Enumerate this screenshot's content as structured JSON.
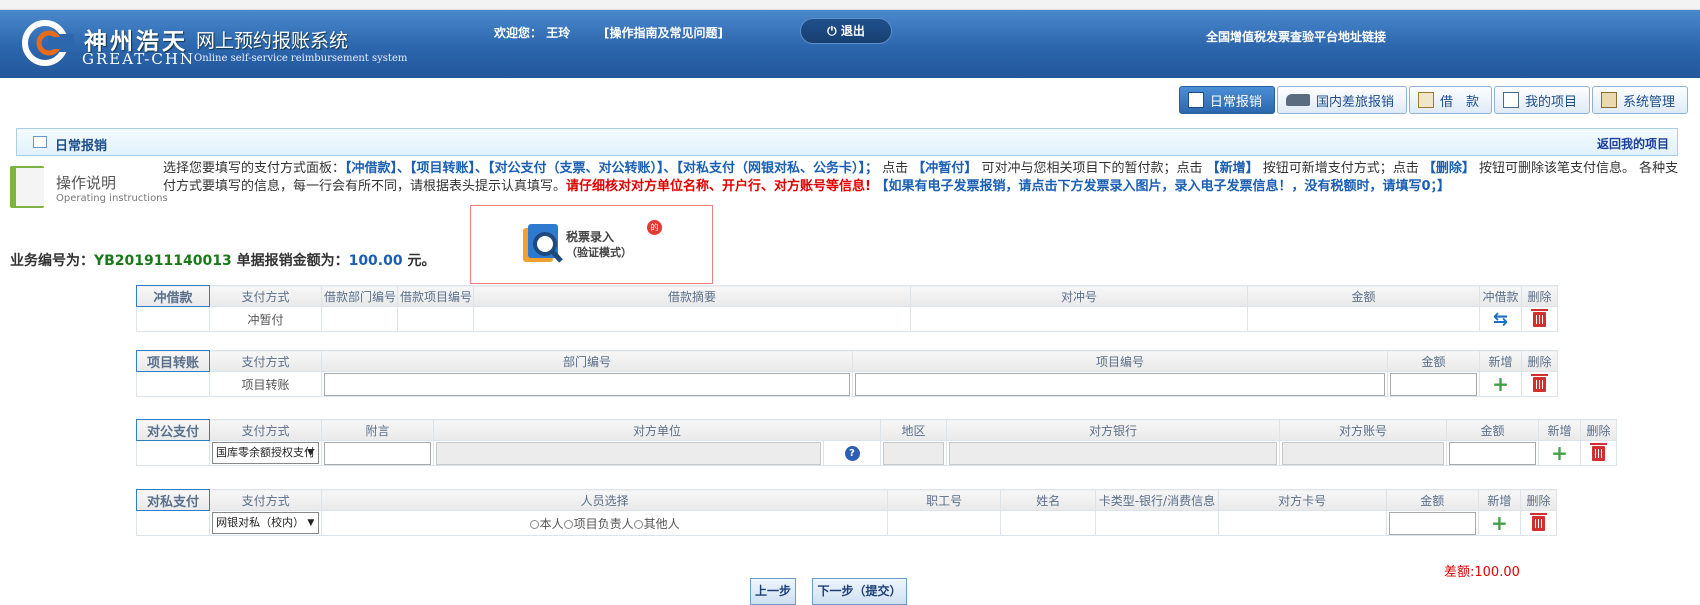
{
  "header": {
    "logo_cn": "神州浩天",
    "logo_en": "GREAT-CHN",
    "system_title": "网上预约报账系统",
    "system_subtitle": "Online self-service reimbursement system",
    "welcome_label": "欢迎您：",
    "user_name": "王玲",
    "guide_link": "[操作指南及常见问题]",
    "logout_label": "退出",
    "vat_link": "全国增值税发票查验平台地址链接"
  },
  "nav": {
    "items": [
      {
        "label": "日常报销",
        "active": true,
        "icon": "receipt-icon"
      },
      {
        "label": "国内差旅报销",
        "active": false,
        "icon": "train-icon"
      },
      {
        "label": "借　款",
        "active": false,
        "icon": "loan-icon"
      },
      {
        "label": "我的项目",
        "active": false,
        "icon": "project-icon"
      },
      {
        "label": "系统管理",
        "active": false,
        "icon": "settings-icon"
      }
    ]
  },
  "section": {
    "title": "日常报销",
    "back_link": "返回我的项目"
  },
  "instructions": {
    "title": "操作说明",
    "subtitle": "Operating instructions",
    "t1": "选择您要填写的支付方式面板：",
    "b1": "【冲借款】、【项目转账】、【对公支付（支票、对公转账）】、【对私支付（网银对私、公务卡）】；",
    "t2": " 点击 ",
    "b2": "【冲暂付】",
    "t3": " 可对冲与您相关项目下的暂付款；点击 ",
    "b3": "【新增】",
    "t4": " 按钮可新增支付方式；点击 ",
    "b4": "【删除】",
    "t5": " 按钮可删除该笔支付信息。 各种支付方式要填写的信息，每一行会有所不同，请根据表头提示认真填写。",
    "r1": "请仔细核对对方单位名称、开户行、对方账号等信息!",
    "b5": " 【如果有电子发票报销，请点击下方发票录入图片，录入电子发票信息！，没有税额时，请填写0；】"
  },
  "tax_entry": {
    "line1": "税票录入",
    "line2": "（验证模式）",
    "badge": "的"
  },
  "business": {
    "number_label": "业务编号为：",
    "number": "YB201911140013",
    "amount_label": " 单据报销金额为：",
    "amount": "100.00",
    "unit": " 元。"
  },
  "offset_loan": {
    "section_label": "冲借款",
    "headers": [
      "支付方式",
      "借款部门编号",
      "借款项目编号",
      "借款摘要",
      "对冲号",
      "金额",
      "冲借款",
      "删除"
    ],
    "row_method": "冲暂付"
  },
  "project_transfer": {
    "section_label": "项目转账",
    "headers": [
      "支付方式",
      "部门编号",
      "项目编号",
      "金额",
      "新增",
      "删除"
    ],
    "row_method": "项目转账"
  },
  "public_payment": {
    "section_label": "对公支付",
    "headers": [
      "支付方式",
      "附言",
      "对方单位",
      "地区",
      "对方银行",
      "对方账号",
      "金额",
      "新增",
      "删除"
    ],
    "select_value": "国库零余额授权支付"
  },
  "private_payment": {
    "section_label": "对私支付",
    "headers": [
      "支付方式",
      "人员选择",
      "职工号",
      "姓名",
      "卡类型-银行/消费信息",
      "对方卡号",
      "金额",
      "新增",
      "删除"
    ],
    "select_value": "网银对私（校内）",
    "radio_options": [
      "本人",
      "项目负责人",
      "其他人"
    ]
  },
  "footer": {
    "diff_label": "差额:",
    "diff_value": "100.00",
    "prev_button": "上一步",
    "next_button": "下一步（提交）"
  },
  "colors": {
    "banner": "#2c66ad",
    "section_tag": "#2f7ec9",
    "warning": "#e00000",
    "highlight_blue": "#1a5fb4"
  }
}
